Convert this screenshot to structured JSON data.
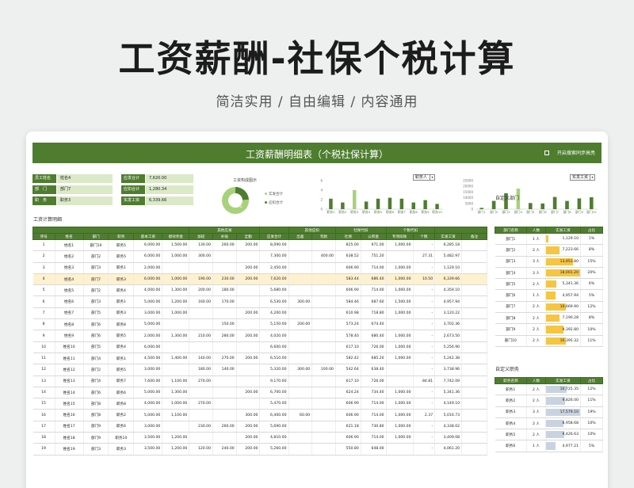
{
  "hero": {
    "title": "工资薪酬-社保个税计算",
    "subtitle": "简洁实用 / 自由编辑 / 内容通用"
  },
  "banner": {
    "title": "工资薪酬明细表（个税社保计算）",
    "toggle_label": "开启搜索同步高亮"
  },
  "info": [
    {
      "key": "员工姓名",
      "value": "姓名4"
    },
    {
      "key": "部　门",
      "value": "部门7"
    },
    {
      "key": "职　务",
      "value": "职务3"
    }
  ],
  "totals": [
    {
      "key": "应发合计",
      "value": "7,620.00"
    },
    {
      "key": "应扣合计",
      "value": "1,280.34"
    },
    {
      "key": "实发工资",
      "value": "6,339.66"
    }
  ],
  "donut": {
    "title": "工资构成图示",
    "legend": [
      "实发合计",
      "应扣合计"
    ],
    "center_label": "76%",
    "share": 0.76,
    "colors": {
      "main": "#a8d27a",
      "minor": "#4f7d2f"
    }
  },
  "chart_data": [
    {
      "type": "bar",
      "categories": [
        "职务1",
        "职务2",
        "职务3",
        "职务4",
        "职务5",
        "职务6",
        "职务7",
        "职务8",
        "职务9",
        "职务10"
      ],
      "values": [
        2.2,
        1.4,
        4.0,
        1.6,
        2.2,
        2.4,
        2.2,
        1.4,
        1.9,
        1.1
      ],
      "ylim": [
        0,
        6
      ],
      "yticks": [
        "0",
        "2",
        "4",
        "6"
      ],
      "highlight_index": 2,
      "dropdown": "职务人"
    },
    {
      "type": "bar",
      "categories": [
        "部门1",
        "部门2",
        "部门3",
        "部门4",
        "部门5",
        "部门6",
        "部门7",
        "部门8",
        "部门9",
        "部门10"
      ],
      "values": [
        1129.1,
        7223.66,
        13953.8,
        18001.2,
        5341.36,
        4957.94,
        10669.9,
        7190.28,
        9392.8,
        10395.32
      ],
      "ylim": [
        0,
        25000
      ],
      "yticks": [
        "0",
        "5000",
        "10000",
        "15000",
        "20000",
        "25000"
      ],
      "highlight_index": 3,
      "dropdown": "实发工资"
    }
  ],
  "main_table": {
    "section_label": "工资计算明细",
    "groups": [
      "其他应发",
      "其他应扣",
      "社保代扣",
      "个税代扣"
    ],
    "headers": [
      "序号",
      "姓名",
      "部门",
      "职务",
      "基本工资",
      "绩效奖金",
      "加班",
      "补贴",
      "全勤",
      "应发合计",
      "出差",
      "罚款",
      "社保",
      "公积金",
      "专项扣除",
      "个税",
      "实发工资",
      "备注"
    ],
    "rows": [
      [
        "1",
        "姓名1",
        "部门10",
        "职务5",
        "6,000.00",
        "1,500.00",
        "130.00",
        "260.00",
        "200.00",
        "8,090.00",
        "",
        "",
        "825.00",
        "971.00",
        "1,000.00",
        "-",
        "6,285.18",
        ""
      ],
      [
        "2",
        "姓名2",
        "部门2",
        "职务5",
        "6,000.00",
        "1,000.00",
        "300.00",
        "",
        "",
        "7,300.00",
        "",
        "400.00",
        "638.52",
        "751.20",
        "",
        "27.31",
        "5,482.97",
        ""
      ],
      [
        "3",
        "姓名3",
        "部门3",
        "职务1",
        "2,000.00",
        "",
        "",
        "",
        "200.00",
        "2,450.00",
        "",
        "",
        "606.90",
        "714.00",
        "1,000.00",
        "-",
        "1,129.10",
        ""
      ],
      [
        "4",
        "姓名4",
        "部门7",
        "职务3",
        "6,000.00",
        "1,000.00",
        "190.00",
        "230.00",
        "200.00",
        "7,620.00",
        "",
        "",
        "583.44",
        "686.40",
        "1,000.00",
        "10.50",
        "6,339.66",
        ""
      ],
      [
        "5",
        "姓名5",
        "部门2",
        "职务4",
        "4,000.00",
        "1,300.00",
        "200.00",
        "180.00",
        "",
        "5,680.00",
        "",
        "",
        "606.90",
        "714.00",
        "1,000.00",
        "-",
        "4,359.10",
        ""
      ],
      [
        "6",
        "姓名6",
        "部门3",
        "职务1",
        "5,000.00",
        "1,200.00",
        "160.00",
        "170.00",
        "",
        "6,530.00",
        "300.00",
        "",
        "584.46",
        "687.60",
        "1,500.00",
        "-",
        "4,957.94",
        ""
      ],
      [
        "7",
        "姓名7",
        "部门5",
        "职务3",
        "3,000.00",
        "1,000.00",
        "",
        "",
        "200.00",
        "4,200.00",
        "",
        "",
        "610.98",
        "718.80",
        "1,000.00",
        "-",
        "3,120.22",
        ""
      ],
      [
        "8",
        "姓名8",
        "部门6",
        "职务8",
        "5,000.00",
        "",
        "",
        "150.00",
        "",
        "5,150.00",
        "200.00",
        "",
        "573.24",
        "674.40",
        "",
        "-",
        "3,702.36",
        ""
      ],
      [
        "9",
        "姓名9",
        "部门6",
        "职务5",
        "2,000.00",
        "1,300.00",
        "210.00",
        "280.00",
        "200.00",
        "4,020.00",
        "",
        "",
        "578.40",
        "680.40",
        "1,000.00",
        "-",
        "2,673.50",
        ""
      ],
      [
        "10",
        "姓名10",
        "部门5",
        "职务4",
        "6,000.00",
        "",
        "",
        "",
        "",
        "6,600.00",
        "",
        "",
        "617.10",
        "726.00",
        "1,000.00",
        "-",
        "5,256.90",
        ""
      ],
      [
        "11",
        "姓名11",
        "部门4",
        "职务1",
        "4,500.00",
        "1,400.00",
        "140.00",
        "270.00",
        "200.00",
        "6,510.00",
        "",
        "",
        "582.42",
        "685.20",
        "1,000.00",
        "-",
        "5,242.38",
        ""
      ],
      [
        "12",
        "姓名12",
        "部门2",
        "职务5",
        "3,000.00",
        "",
        "180.00",
        "140.00",
        "",
        "5,320.00",
        "300.00",
        "100.00",
        "542.64",
        "638.40",
        "",
        "-",
        "3,738.96",
        ""
      ],
      [
        "13",
        "姓名13",
        "部门4",
        "职务7",
        "7,600.00",
        "1,100.00",
        "270.00",
        "",
        "",
        "9,170.00",
        "",
        "",
        "617.10",
        "726.00",
        "",
        "84.81",
        "7,742.09",
        ""
      ],
      [
        "14",
        "姓名14",
        "部门6",
        "职务6",
        "5,000.00",
        "1,300.00",
        "",
        "",
        "200.00",
        "6,700.00",
        "",
        "",
        "624.24",
        "734.40",
        "1,000.00",
        "-",
        "5,341.36",
        ""
      ],
      [
        "15",
        "姓名15",
        "部门8",
        "职务8",
        "4,000.00",
        "1,000.00",
        "270.00",
        "",
        "",
        "5,470.00",
        "",
        "",
        "606.90",
        "714.00",
        "1,000.00",
        "-",
        "4,149.10",
        ""
      ],
      [
        "16",
        "姓名16",
        "部门8",
        "职务2",
        "5,000.00",
        "1,100.00",
        "",
        "",
        "300.00",
        "6,400.00",
        "60.00",
        "",
        "606.90",
        "714.00",
        "1,000.00",
        "2.37",
        "5,016.73",
        ""
      ],
      [
        "17",
        "姓名17",
        "部门9",
        "职务6",
        "3,000.00",
        "",
        "230.00",
        "260.00",
        "200.00",
        "5,690.00",
        "",
        "",
        "621.18",
        "730.80",
        "1,000.00",
        "-",
        "4,338.02",
        ""
      ],
      [
        "18",
        "姓名18",
        "部门9",
        "职务10",
        "3,500.00",
        "1,200.00",
        "",
        "",
        "200.00",
        "4,810.00",
        "",
        "",
        "606.90",
        "714.00",
        "1,000.00",
        "-",
        "3,409.08",
        ""
      ],
      [
        "19",
        "姓名19",
        "部门3",
        "职务3",
        "3,500.00",
        "1,200.00",
        "120.00",
        "240.00",
        "200.00",
        "5,260.00",
        "",
        "",
        "550.80",
        "648.00",
        "",
        "-",
        "4,061.20",
        ""
      ]
    ],
    "highlight_row": 3
  },
  "dept_table": {
    "section_label": "自定义部门",
    "headers": [
      "部门名称",
      "人数",
      "实发工资",
      "占比"
    ],
    "rows": [
      [
        "部门1",
        "1 人",
        "1,129.10",
        "1%",
        0.06
      ],
      [
        "部门2",
        "2 人",
        "7,223.66",
        "8%",
        0.4
      ],
      [
        "部门3",
        "3 人",
        "13,953.80",
        "15%",
        0.78
      ],
      [
        "部门4",
        "3 人",
        "18,001.20",
        "20%",
        1.0
      ],
      [
        "部门5",
        "2 人",
        "5,341.36",
        "6%",
        0.3
      ],
      [
        "部门6",
        "1 人",
        "4,957.94",
        "5%",
        0.28
      ],
      [
        "部门7",
        "2 人",
        "10,669.90",
        "12%",
        0.59
      ],
      [
        "部门8",
        "2 人",
        "7,190.28",
        "8%",
        0.4
      ],
      [
        "部门9",
        "2 人",
        "9,392.80",
        "10%",
        0.52
      ],
      [
        "部门10",
        "2 人",
        "10,395.32",
        "11%",
        0.58
      ]
    ]
  },
  "duty_table": {
    "section_label": "自定义职务",
    "headers": [
      "职务名称",
      "人数",
      "实发工资",
      "占比"
    ],
    "rows": [
      [
        "职务1",
        "2 人",
        "10,725.35",
        "12%",
        0.61
      ],
      [
        "职务2",
        "2 人",
        "9,826.00",
        "11%",
        0.56
      ],
      [
        "职务3",
        "3 人",
        "17,579.10",
        "19%",
        1.0
      ],
      [
        "职务4",
        "2 人",
        "8,958.68",
        "10%",
        0.51
      ],
      [
        "职务5",
        "2 人",
        "9,426.63",
        "10%",
        0.54
      ],
      [
        "职务6",
        "1 人",
        "4,977.21",
        "5%",
        0.28
      ]
    ]
  }
}
